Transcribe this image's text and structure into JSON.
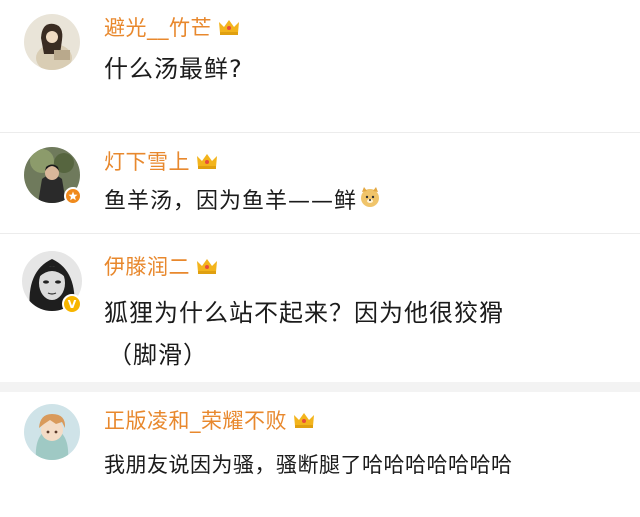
{
  "comments": [
    {
      "user": "避光__竹芒",
      "text": "什么汤最鲜?",
      "avatar_icon": "girl-reading-avatar"
    },
    {
      "user": "灯下雪上",
      "text": "鱼羊汤，因为鱼羊——鲜",
      "emoji_icon": "doge-emoji",
      "avatar_icon": "dark-figure-avatar",
      "badge_icon": "orange-star-badge"
    },
    {
      "user": "伊滕润二",
      "text_line1": "狐狸为什么站不起来？因为他很狡猾",
      "text_line2": "（脚滑）",
      "avatar_icon": "long-hair-face-avatar",
      "badge_icon": "verified-v-badge"
    },
    {
      "user": "正版凌和_荣耀不败",
      "text": "我朋友说因为骚，骚断腿了哈哈哈哈哈哈哈",
      "avatar_icon": "anime-boy-avatar"
    }
  ],
  "colors": {
    "username": "#e8882d",
    "text": "#1b1b1b",
    "crown_gold": "#f3b41c",
    "separator": "#ececec",
    "badge": "#f7b500"
  }
}
